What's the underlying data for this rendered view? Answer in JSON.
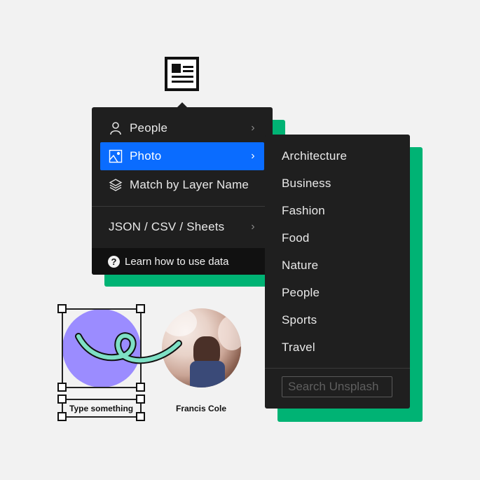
{
  "icons": {
    "top": "document-layout-icon",
    "people": "person-icon",
    "photo": "image-icon",
    "layers": "layers-icon",
    "help": "question-circle-icon",
    "chevron": "chevron-right-icon"
  },
  "colors": {
    "background": "#f2f2f2",
    "menu_bg": "#1f1f1f",
    "accent": "#0a6cff",
    "green": "#00b374",
    "purple_circle": "#9b8cff",
    "squiggle": "#7ee0c5"
  },
  "main_menu": {
    "items": [
      {
        "label": "People",
        "chevron": "›"
      },
      {
        "label": "Photo",
        "chevron": "›",
        "active": true
      },
      {
        "label": "Match by Layer Name"
      }
    ],
    "data_item": {
      "label": "JSON / CSV / Sheets",
      "chevron": "›"
    },
    "help_icon": "?",
    "learn_label": "Learn how to use data"
  },
  "photo_submenu": {
    "items": [
      "Architecture",
      "Business",
      "Fashion",
      "Food",
      "Nature",
      "People",
      "Sports",
      "Travel"
    ],
    "search_placeholder": "Search Unsplash"
  },
  "canvas": {
    "text_layer": "Type something",
    "avatar_caption": "Francis Cole"
  }
}
